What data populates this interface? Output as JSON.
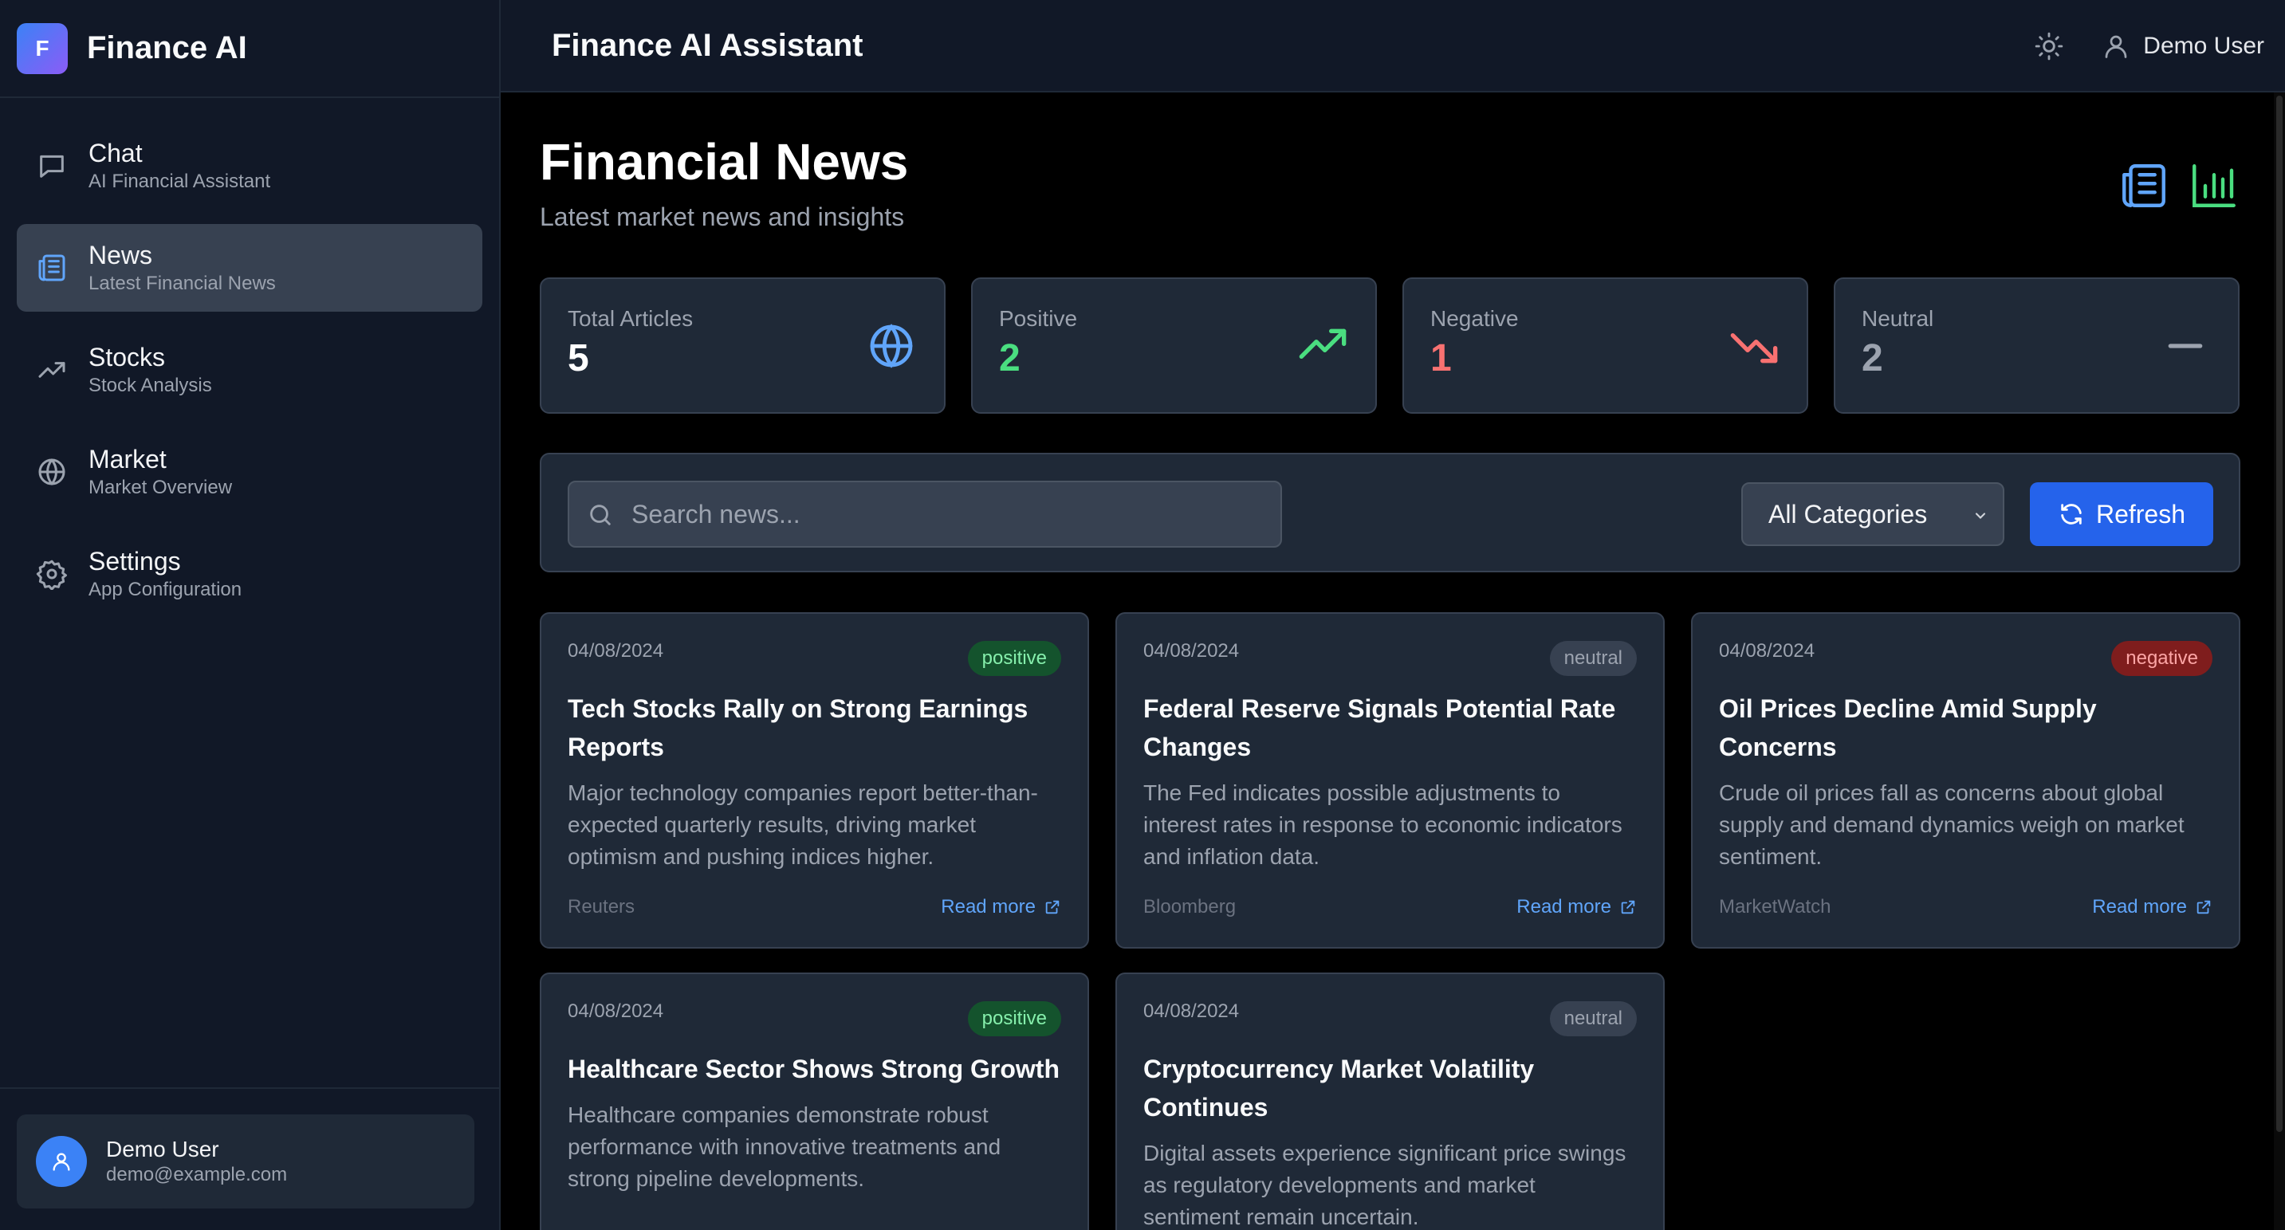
{
  "brand": {
    "logo_letter": "F",
    "name": "Finance AI"
  },
  "sidebar": {
    "items": [
      {
        "title": "Chat",
        "subtitle": "AI Financial Assistant",
        "icon": "chat-icon"
      },
      {
        "title": "News",
        "subtitle": "Latest Financial News",
        "icon": "news-icon",
        "active": true
      },
      {
        "title": "Stocks",
        "subtitle": "Stock Analysis",
        "icon": "trending-up-icon"
      },
      {
        "title": "Market",
        "subtitle": "Market Overview",
        "icon": "globe-icon"
      },
      {
        "title": "Settings",
        "subtitle": "App Configuration",
        "icon": "gear-icon"
      }
    ],
    "user": {
      "name": "Demo User",
      "email": "demo@example.com"
    }
  },
  "header": {
    "title": "Finance AI Assistant",
    "user_name": "Demo User"
  },
  "page": {
    "title": "Financial News",
    "subtitle": "Latest market news and insights"
  },
  "stats": [
    {
      "label": "Total Articles",
      "value": "5",
      "color": "#ffffff",
      "icon": "globe-icon"
    },
    {
      "label": "Positive",
      "value": "2",
      "color": "#4ade80",
      "icon": "trending-up-icon"
    },
    {
      "label": "Negative",
      "value": "1",
      "color": "#f87171",
      "icon": "trending-down-icon"
    },
    {
      "label": "Neutral",
      "value": "2",
      "color": "#9ca3af",
      "icon": "minus-icon"
    }
  ],
  "toolbar": {
    "search_placeholder": "Search news...",
    "category_selected": "All Categories",
    "refresh_label": "Refresh"
  },
  "articles": [
    {
      "date": "04/08/2024",
      "sentiment": "positive",
      "title": "Tech Stocks Rally on Strong Earnings Reports",
      "description": "Major technology companies report better-than-expected quarterly results, driving market optimism and pushing indices higher.",
      "source": "Reuters",
      "link_label": "Read more"
    },
    {
      "date": "04/08/2024",
      "sentiment": "neutral",
      "title": "Federal Reserve Signals Potential Rate Changes",
      "description": "The Fed indicates possible adjustments to interest rates in response to economic indicators and inflation data.",
      "source": "Bloomberg",
      "link_label": "Read more"
    },
    {
      "date": "04/08/2024",
      "sentiment": "negative",
      "title": "Oil Prices Decline Amid Supply Concerns",
      "description": "Crude oil prices fall as concerns about global supply and demand dynamics weigh on market sentiment.",
      "source": "MarketWatch",
      "link_label": "Read more"
    },
    {
      "date": "04/08/2024",
      "sentiment": "positive",
      "title": "Healthcare Sector Shows Strong Growth",
      "description": "Healthcare companies demonstrate robust performance with innovative treatments and strong pipeline developments.",
      "source": "",
      "link_label": ""
    },
    {
      "date": "04/08/2024",
      "sentiment": "neutral",
      "title": "Cryptocurrency Market Volatility Continues",
      "description": "Digital assets experience significant price swings as regulatory developments and market sentiment remain uncertain.",
      "source": "",
      "link_label": ""
    }
  ]
}
